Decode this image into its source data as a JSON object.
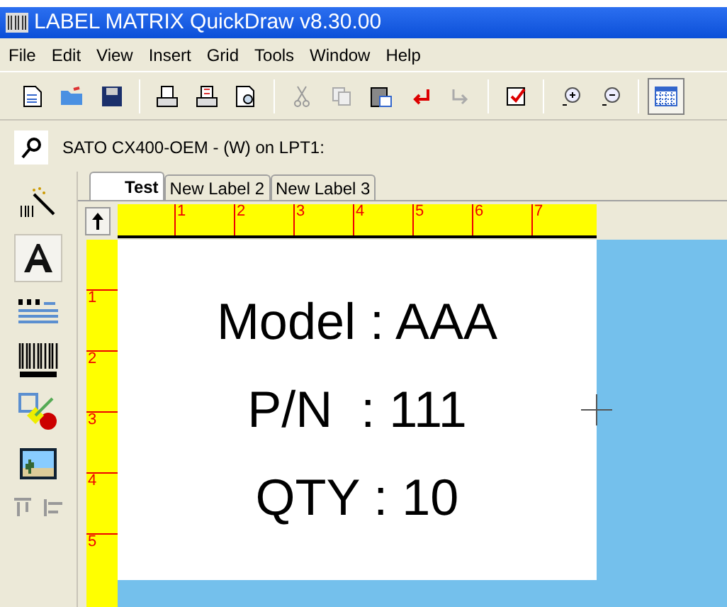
{
  "window": {
    "title": "LABEL MATRIX QuickDraw v8.30.00"
  },
  "menu": [
    "File",
    "Edit",
    "View",
    "Insert",
    "Grid",
    "Tools",
    "Window",
    "Help"
  ],
  "toolbar": {
    "grid_pressed": true
  },
  "printer": {
    "name": "SATO CX400-OEM - (W) on LPT1:"
  },
  "tabs": [
    {
      "label": "Test",
      "selected": true
    },
    {
      "label": "New Label 2",
      "selected": false
    },
    {
      "label": "New Label 3",
      "selected": false
    }
  ],
  "rulers": {
    "horizontal": [
      "1",
      "2",
      "3",
      "4",
      "5",
      "6",
      "7"
    ],
    "vertical": [
      "1",
      "2",
      "3",
      "4",
      "5"
    ]
  },
  "label_lines": [
    "Model : AAA",
    "P/N  : 111",
    "QTY : 10"
  ]
}
